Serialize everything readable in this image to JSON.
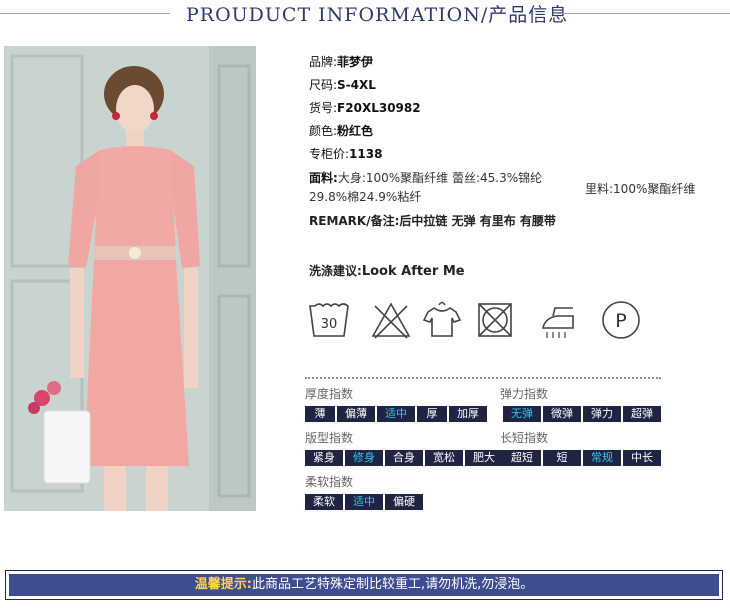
{
  "header": {
    "title": "PROUDUCT INFORMATION/产品信息"
  },
  "details": {
    "brand": {
      "label": "品牌:",
      "value": "菲梦伊"
    },
    "size": {
      "label": "尺码:",
      "value": "S-4XL"
    },
    "sku": {
      "label": "货号:",
      "value": "F20XL30982"
    },
    "color": {
      "label": "颜色:",
      "value": "粉红色"
    },
    "price": {
      "label": "专柜价:",
      "value": "1138"
    },
    "fabric": {
      "label": "面料:",
      "line1": "大身:100%聚酯纤维 蕾丝:45.3%锦纶",
      "line2": "29.8%棉24.9%粘纤"
    },
    "lining": "里料:100%聚酯纤维",
    "remark": {
      "label": "REMARK/备注:",
      "value": "后中拉链 无弹 有里布 有腰带"
    },
    "care": {
      "label": "洗涤建议:",
      "value": "Look After Me"
    }
  },
  "care_icons": [
    {
      "name": "wash-30-icon",
      "text": "30"
    },
    {
      "name": "no-bleach-icon",
      "text": ""
    },
    {
      "name": "hang-dry-icon",
      "text": ""
    },
    {
      "name": "no-tumble-dry-icon",
      "text": ""
    },
    {
      "name": "low-iron-icon",
      "text": ""
    },
    {
      "name": "dry-clean-p-icon",
      "text": "P"
    }
  ],
  "indices": {
    "thickness": {
      "label": "厚度指数",
      "options": [
        "薄",
        "偏薄",
        "适中",
        "厚",
        "加厚"
      ],
      "selected": "适中"
    },
    "elasticity": {
      "label": "弹力指数",
      "options": [
        "无弹",
        "微弹",
        "弹力",
        "超弹"
      ],
      "selected": "无弹"
    },
    "fit": {
      "label": "版型指数",
      "options": [
        "紧身",
        "修身",
        "合身",
        "宽松",
        "肥大"
      ],
      "selected": "修身"
    },
    "length": {
      "label": "长短指数",
      "options": [
        "超短",
        "短",
        "常规",
        "中长"
      ],
      "selected": "常规"
    },
    "softness": {
      "label": "柔软指数",
      "options": [
        "柔软",
        "适中",
        "偏硬"
      ],
      "selected": "适中"
    }
  },
  "footer": {
    "highlight": "温馨提示:",
    "text": "此商品工艺特殊定制比较重工,请勿机洗,勿浸泡。"
  },
  "colors": {
    "navy": "#2c3a6e",
    "tag_bg": "#1f2442",
    "tag_active": "#35c4f5",
    "footer_bg": "#3e4d90",
    "footer_highlight": "#ffd54a"
  }
}
